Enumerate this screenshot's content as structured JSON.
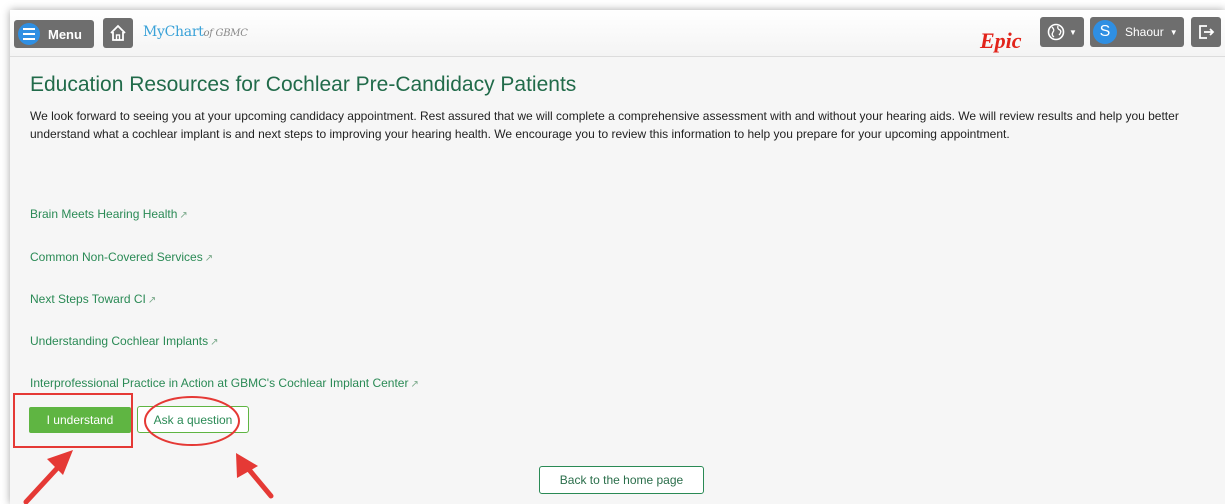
{
  "header": {
    "menu_label": "Menu",
    "logo_text": "MyChart",
    "logo_suffix": "of GBMC",
    "vendor_logo": "Epic",
    "user_initial": "S",
    "user_name": "Shaour",
    "icons": [
      "hamburger-icon",
      "home-icon",
      "globe-icon",
      "chevron-down-icon",
      "logout-icon"
    ]
  },
  "page": {
    "title": "Education Resources for Cochlear Pre-Candidacy Patients",
    "intro": "We look forward to seeing you at your upcoming candidacy appointment. Rest assured that we will complete a comprehensive assessment with and without your hearing aids. We will review results and help you better understand what a cochlear implant is and next steps to improving your hearing health. We encourage you to review this information to help you prepare for your upcoming appointment."
  },
  "links": [
    "Brain Meets Hearing Health",
    "Common Non-Covered Services",
    "Next Steps Toward CI",
    "Understanding Cochlear Implants",
    "Interprofessional Practice in Action at GBMC's Cochlear Implant Center"
  ],
  "actions": {
    "understand_label": "I understand",
    "ask_label": "Ask a question",
    "back_label": "Back to the home page"
  },
  "colors": {
    "accent_green": "#5fb542",
    "link_green": "#2a8a55",
    "annotation_red": "#e53935",
    "epic_red": "#e2231a",
    "avatar_blue": "#2f8fe3"
  }
}
